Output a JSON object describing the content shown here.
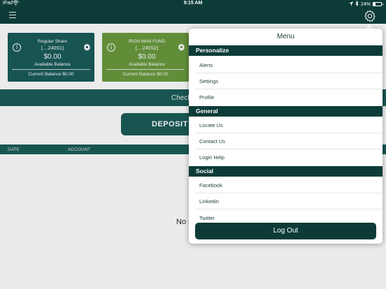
{
  "status_bar": {
    "carrier": "iPad",
    "time": "9:15 AM",
    "battery_text": "24%",
    "battery_level": 0.24,
    "icons": [
      "wifi-icon",
      "location-icon",
      "bluetooth-icon",
      "battery-icon"
    ]
  },
  "nav": {
    "icons": [
      "hamburger-menu-icon",
      "settings-gear-icon"
    ]
  },
  "accounts": [
    {
      "name": "Regular Share",
      "number": "(....240S1)",
      "amount": "$0.00",
      "available_label": "Available Balance",
      "current_balance": "Current Balance $0.00",
      "color": "#1a5c5a"
    },
    {
      "name": "IRON MAN FUND",
      "number": "(....240S2)",
      "amount": "$0.00",
      "available_label": "Available Balance",
      "current_balance": "Current Balance $0.00",
      "color": "#6a9a3e"
    }
  ],
  "band": {
    "label": "Check"
  },
  "deposit_button": "DEPOSIT A",
  "table": {
    "col_date": "DATE",
    "col_account": "ACCOUNT"
  },
  "empty_text": "No r",
  "menu": {
    "title": "Menu",
    "sections": [
      {
        "title": "Personalize",
        "items": [
          "Alerts",
          "Settings",
          "Profile"
        ]
      },
      {
        "title": "General",
        "items": [
          "Locate Us",
          "Contact Us",
          "Login Help"
        ]
      },
      {
        "title": "Social",
        "items": [
          "Facebook",
          "Linkedin",
          "Twitter"
        ]
      }
    ],
    "logout": "Log Out"
  },
  "colors": {
    "brand_dark": "#0d3c38",
    "brand_teal": "#1b5d58",
    "card_green": "#6a9a3e"
  }
}
